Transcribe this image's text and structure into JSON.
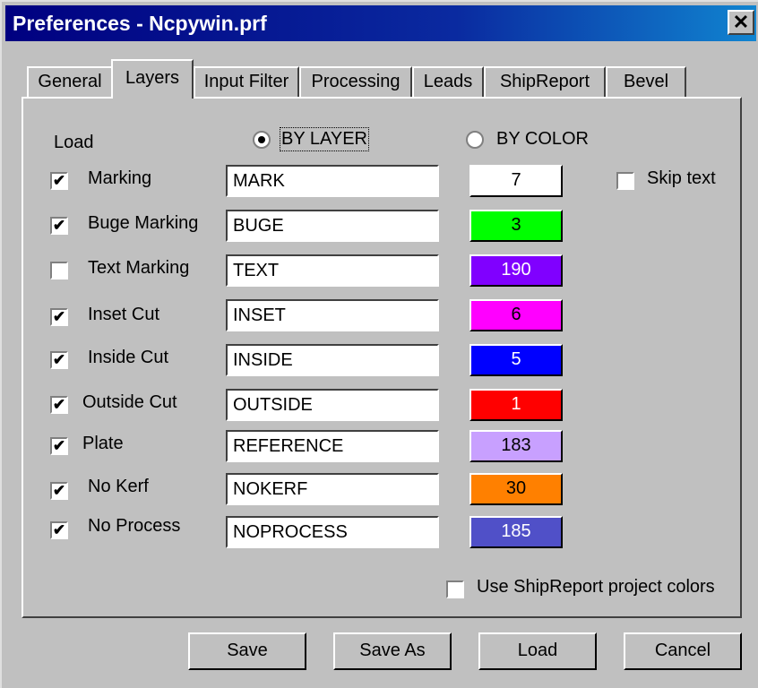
{
  "window": {
    "title": "Preferences - Ncpywin.prf",
    "close_glyph": "✕"
  },
  "tabs": [
    {
      "label": "General"
    },
    {
      "label": "Layers",
      "active": true
    },
    {
      "label": "Input Filter"
    },
    {
      "label": "Processing"
    },
    {
      "label": "Leads"
    },
    {
      "label": "ShipReport"
    },
    {
      "label": "Bevel"
    }
  ],
  "layers": {
    "load_label": "Load",
    "load_mode": {
      "by_layer_label": "BY LAYER",
      "by_color_label": "BY COLOR",
      "selected": "BY LAYER"
    },
    "skip_text": {
      "label": "Skip text",
      "checked": false
    },
    "rows": [
      {
        "label": "Marking",
        "checked": true,
        "layer": "MARK",
        "color_index": "7",
        "color": "#ffffff"
      },
      {
        "label": "Buge Marking",
        "checked": true,
        "layer": "BUGE",
        "color_index": "3",
        "color": "#00ff00"
      },
      {
        "label": "Text Marking",
        "checked": false,
        "layer": "TEXT",
        "color_index": "190",
        "color": "#8000ff"
      },
      {
        "label": "Inset Cut",
        "checked": true,
        "layer": "INSET",
        "color_index": "6",
        "color": "#ff00ff"
      },
      {
        "label": "Inside Cut",
        "checked": true,
        "layer": "INSIDE",
        "color_index": "5",
        "color": "#0000ff"
      },
      {
        "label": "Outside Cut",
        "checked": true,
        "layer": "OUTSIDE",
        "color_index": "1",
        "color": "#ff0000"
      },
      {
        "label": "Plate",
        "checked": true,
        "layer": "REFERENCE",
        "color_index": "183",
        "color": "#c8a0ff"
      },
      {
        "label": "No Kerf",
        "checked": true,
        "layer": "NOKERF",
        "color_index": "30",
        "color": "#ff8000"
      },
      {
        "label": "No Process",
        "checked": true,
        "layer": "NOPROCESS",
        "color_index": "185",
        "color": "#5050c8"
      }
    ],
    "use_shipreport_colors": {
      "label": "Use ShipReport project colors",
      "checked": false
    }
  },
  "buttons": {
    "save": "Save",
    "save_as": "Save As",
    "load": "Load",
    "cancel": "Cancel"
  },
  "check_glyph": "✔"
}
